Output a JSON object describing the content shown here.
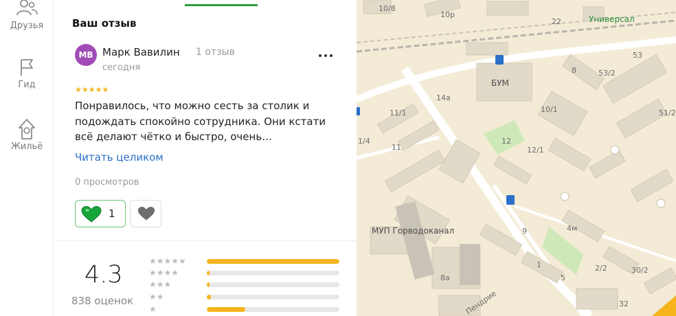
{
  "rail": {
    "items": [
      {
        "label": "Друзья",
        "icon": "friends-icon"
      },
      {
        "label": "Гид",
        "icon": "flag-icon"
      },
      {
        "label": "Жильё",
        "icon": "house-icon"
      }
    ]
  },
  "panel": {
    "title": "Ваш отзыв"
  },
  "review": {
    "avatar_initials": "MB",
    "author": "Марк Вавилин",
    "author_reviews": "1 отзыв",
    "date": "сегодня",
    "stars": "★★★★★",
    "text": "Понравилось, что можно сесть за столик и подождать спокойно сотрудника. Они кстати всё делают чётко и быстро, очень…",
    "read_more": "Читать целиком",
    "views": "0 просмотров",
    "likes": "1"
  },
  "rating": {
    "value": "4.3",
    "count": "838 оценок",
    "distribution": [
      {
        "stars": "★★★★★",
        "fraction": 1.0
      },
      {
        "stars": "★★★★",
        "fraction": 0.02
      },
      {
        "stars": "★★★",
        "fraction": 0.02
      },
      {
        "stars": "★★",
        "fraction": 0.03
      },
      {
        "stars": "★",
        "fraction": 0.29
      }
    ]
  },
  "map": {
    "labels": [
      "10/8",
      "10р",
      "22",
      "Универсал",
      "53",
      "БУМ",
      "8",
      "53/2",
      "14а",
      "11/1",
      "10/1",
      "51/2",
      "1/4",
      "12",
      "12/1",
      "11",
      "9",
      "4м",
      "МУП Горводоканал",
      "1",
      "2/2",
      "30/2",
      "8а",
      "5",
      "Пендрие",
      "32"
    ],
    "colors": {
      "background": "#f3ebd6",
      "building": "#e2dac8",
      "road": "#ffffff",
      "park": "#cfe8b8",
      "accent": "#f6b51d"
    }
  },
  "colors": {
    "accent_green": "#2f9e3a",
    "link": "#2a6fc9",
    "star": "#f6b51d",
    "avatar": "#a14cb6"
  }
}
